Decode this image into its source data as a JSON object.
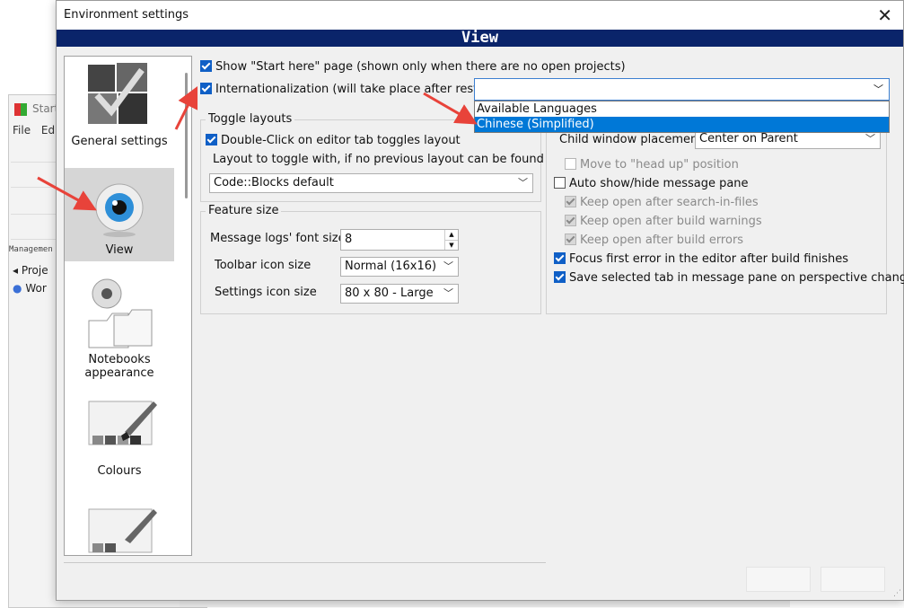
{
  "background_app": {
    "title": "Start",
    "menu": [
      "File",
      "Ed"
    ],
    "management_label": "Managemen",
    "tree": [
      "Proje",
      "Wor"
    ]
  },
  "dialog": {
    "title": "Environment settings",
    "section_header": "View"
  },
  "sidebar": {
    "items": [
      {
        "label": "General settings",
        "icon": "general-settings-icon"
      },
      {
        "label": "View",
        "icon": "eye-icon",
        "selected": true
      },
      {
        "label": "Notebooks appearance",
        "icon": "notebooks-icon"
      },
      {
        "label": "Colours",
        "icon": "palette-icon"
      },
      {
        "label": "",
        "icon": "palette-icon"
      }
    ]
  },
  "options": {
    "show_start_here": "Show \"Start here\" page (shown only when there are no open projects)",
    "internationalization": "Internationalization (will take place after restart)"
  },
  "language_dropdown": {
    "value": "",
    "options": [
      "Available Languages",
      "Chinese (Simplified)"
    ],
    "selected_index": 1
  },
  "toggle_layouts": {
    "title": "Toggle layouts",
    "double_click": "Double-Click on editor tab toggles layout",
    "layout_label": "Layout to toggle with, if no previous layout can be found",
    "layout_value": "Code::Blocks default"
  },
  "feature_size": {
    "title": "Feature size",
    "font_size_label": "Message logs' font size:",
    "font_size_value": "8",
    "toolbar_icon_label": "Toolbar icon size",
    "toolbar_icon_value": "Normal (16x16)",
    "settings_icon_label": "Settings icon size",
    "settings_icon_value": "80 x 80 - Large"
  },
  "right_panel": {
    "child_window_label": "Child window placement",
    "child_window_value": "Center on Parent",
    "move_head_up": "Move to \"head up\" position",
    "auto_show_hide": "Auto show/hide message pane",
    "keep_open_search": "Keep open after search-in-files",
    "keep_open_warnings": "Keep open after build warnings",
    "keep_open_errors": "Keep open after build errors",
    "focus_first_error": "Focus first error in the editor after build finishes",
    "save_selected_tab": "Save selected tab in message pane on perspective change"
  },
  "colors": {
    "header_bg": "#0a246a",
    "accent": "#0078d7",
    "annotation_arrow": "#e8433a"
  }
}
